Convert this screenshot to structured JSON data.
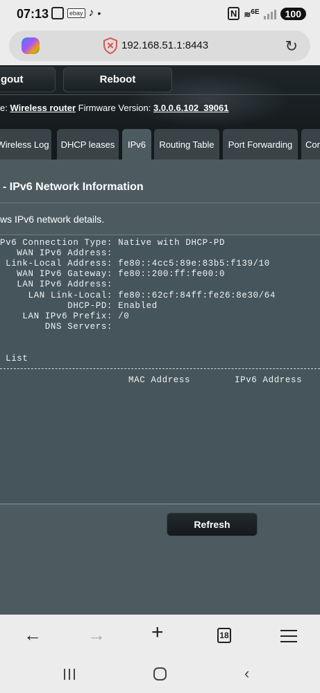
{
  "status_bar": {
    "time": "07:13",
    "ebay": "ebay",
    "wifi_label": "6E",
    "battery": "100"
  },
  "browser": {
    "url": "192.168.51.1:8443",
    "tab_count": "18"
  },
  "router": {
    "logout_label": "gout",
    "reboot_label": "Reboot",
    "mode_prefix": "e:",
    "mode_link": "Wireless router",
    "firmware_label": "Firmware Version:",
    "firmware_version": "3.0.0.6.102_39061",
    "tabs": [
      "Wireless Log",
      "DHCP leases",
      "IPv6",
      "Routing Table",
      "Port Forwarding",
      "Con"
    ],
    "active_tab": "IPv6",
    "section_title": "- IPv6 Network Information",
    "description": "ws IPv6 network details.",
    "log_lines": [
      "Pv6 Connection Type: Native with DHCP-PD",
      "   WAN IPv6 Address:",
      " Link-Local Address: fe80::4cc5:89e:83b5:f139/10",
      "   WAN IPv6 Gateway: fe80::200:ff:fe00:0",
      "   LAN IPv6 Address:",
      "     LAN Link-Local: fe80::62cf:84ff:fe26:8e30/64",
      "            DHCP-PD: Enabled",
      "    LAN IPv6 Prefix: /0",
      "        DNS Servers:"
    ],
    "list_label": " List",
    "col_mac": "MAC Address",
    "col_ipv6": "IPv6 Address",
    "refresh_label": "Refresh"
  }
}
